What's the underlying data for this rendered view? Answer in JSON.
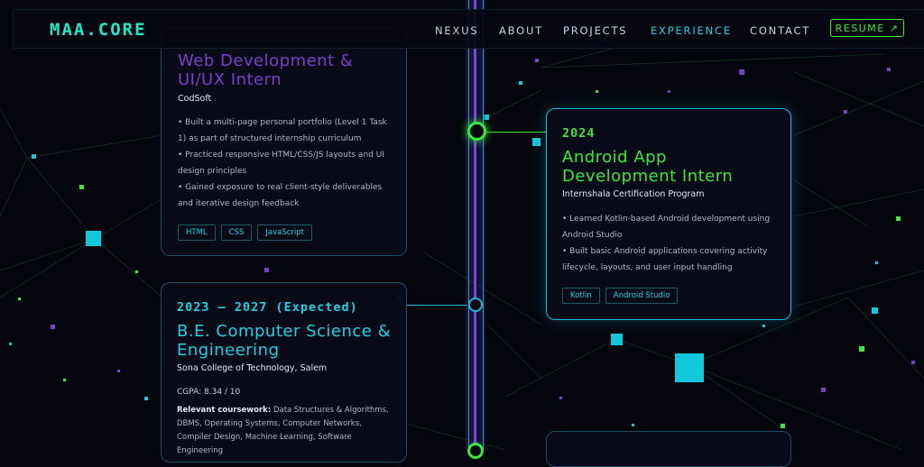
{
  "nav": {
    "logo": "MAA.CORE",
    "links": [
      "NEXUS",
      "ABOUT",
      "PROJECTS",
      "EXPERIENCE",
      "CONTACT"
    ],
    "active": "EXPERIENCE",
    "resume": "RESUME ↗"
  },
  "colors": {
    "accent_cyan": "#16d4e6",
    "accent_green": "#39e83a",
    "accent_purple": "#7a3fc8",
    "background": "#05060d"
  },
  "cards": [
    {
      "title": "Web Development & UI/UX Intern",
      "org": "CodSoft",
      "bullets": [
        "• Built a multi-page personal portfolio (Level 1 Task 1) as part of structured internship curriculum",
        "• Practiced responsive HTML/CSS/JS layouts and UI design principles",
        "• Gained exposure to real client-style deliverables and iterative design feedback"
      ],
      "tags": [
        "HTML",
        "CSS",
        "JavaScript"
      ]
    },
    {
      "year": "2024",
      "title": "Android App Development Intern",
      "org": "Internshala Certification Program",
      "bullets": [
        "• Learned Kotlin-based Android development using Android Studio",
        "• Built basic Android applications covering activity lifecycle, layouts, and user input handling"
      ],
      "tags": [
        "Kotlin",
        "Android Studio"
      ]
    },
    {
      "year": "2023 – 2027 (Expected)",
      "title": "B.E. Computer Science & Engineering",
      "org": "Sona College of Technology, Salem",
      "cgpa": "CGPA: 8.34 / 10",
      "coursework_label": "Relevant coursework:",
      "coursework": "Data Structures & Algorithms, DBMS, Operating Systems, Computer Networks, Compiler Design, Machine Learning, Software Engineering"
    }
  ]
}
